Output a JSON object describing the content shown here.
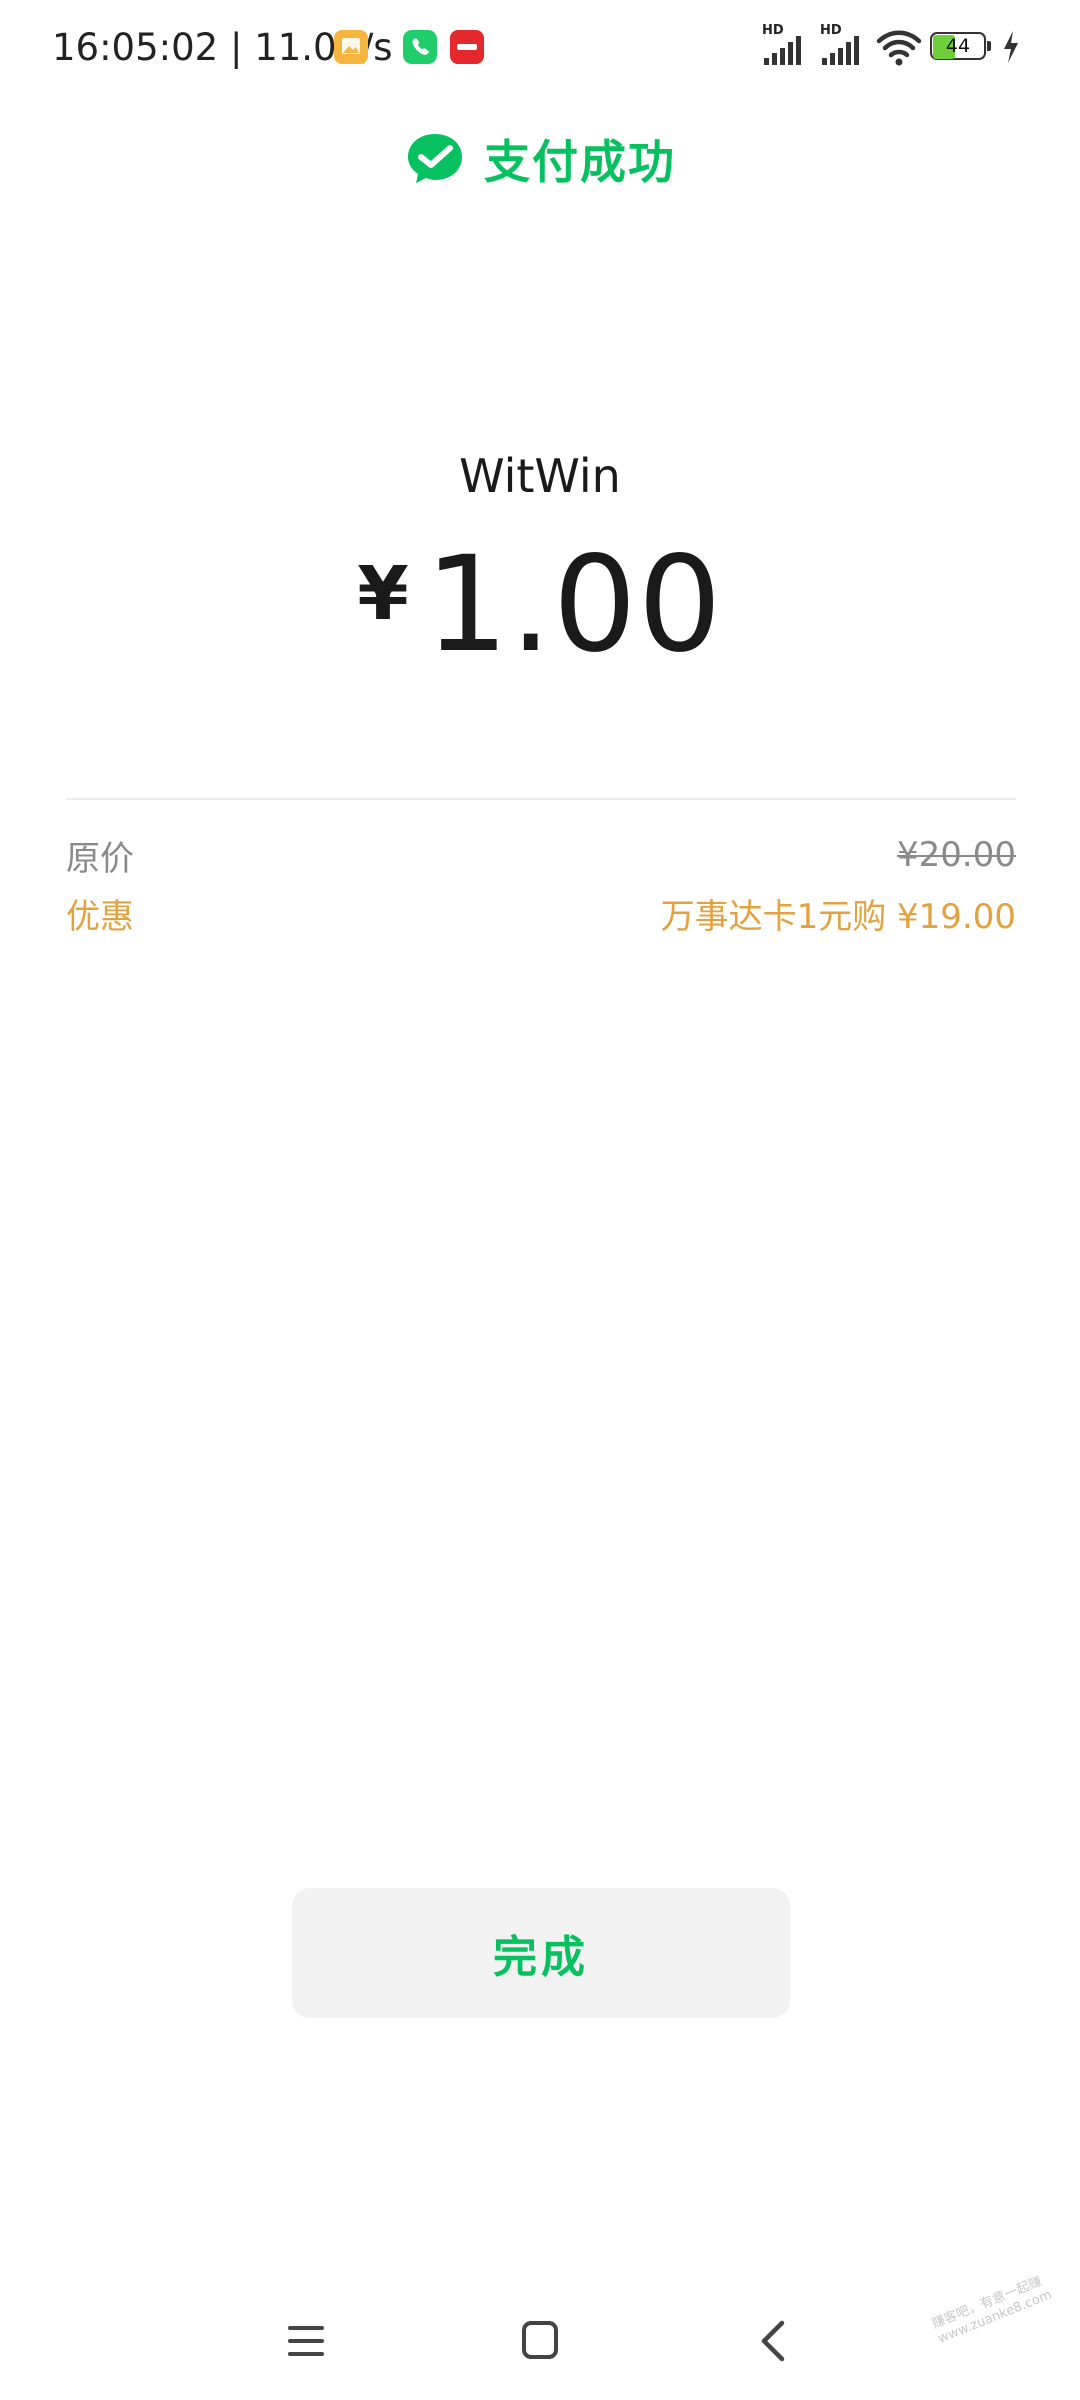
{
  "status_bar": {
    "time": "16:05:02",
    "network_speed": "11.0K/s",
    "notification_icons": [
      "gallery-icon",
      "phone-icon",
      "app-red-icon"
    ],
    "hd_label": "HD",
    "battery_level": "44",
    "battery_fraction": 0.44
  },
  "header": {
    "title": "支付成功",
    "icon": "wechat-pay-check-icon",
    "accent_color": "#07c160"
  },
  "payment": {
    "merchant": "WitWin",
    "currency_symbol": "¥",
    "amount": "1.00"
  },
  "details": {
    "original_label": "原价",
    "original_value": "¥20.00",
    "discount_label": "优惠",
    "discount_value": "万事达卡1元购 ¥19.00",
    "discount_color": "#e3a23e"
  },
  "actions": {
    "done_label": "完成"
  },
  "nav_bar": {
    "items": [
      "menu-icon",
      "home-icon",
      "back-icon"
    ]
  },
  "watermark": {
    "line1": "赚客吧，有意一起赚",
    "line2": "www.zuanke8.com"
  }
}
